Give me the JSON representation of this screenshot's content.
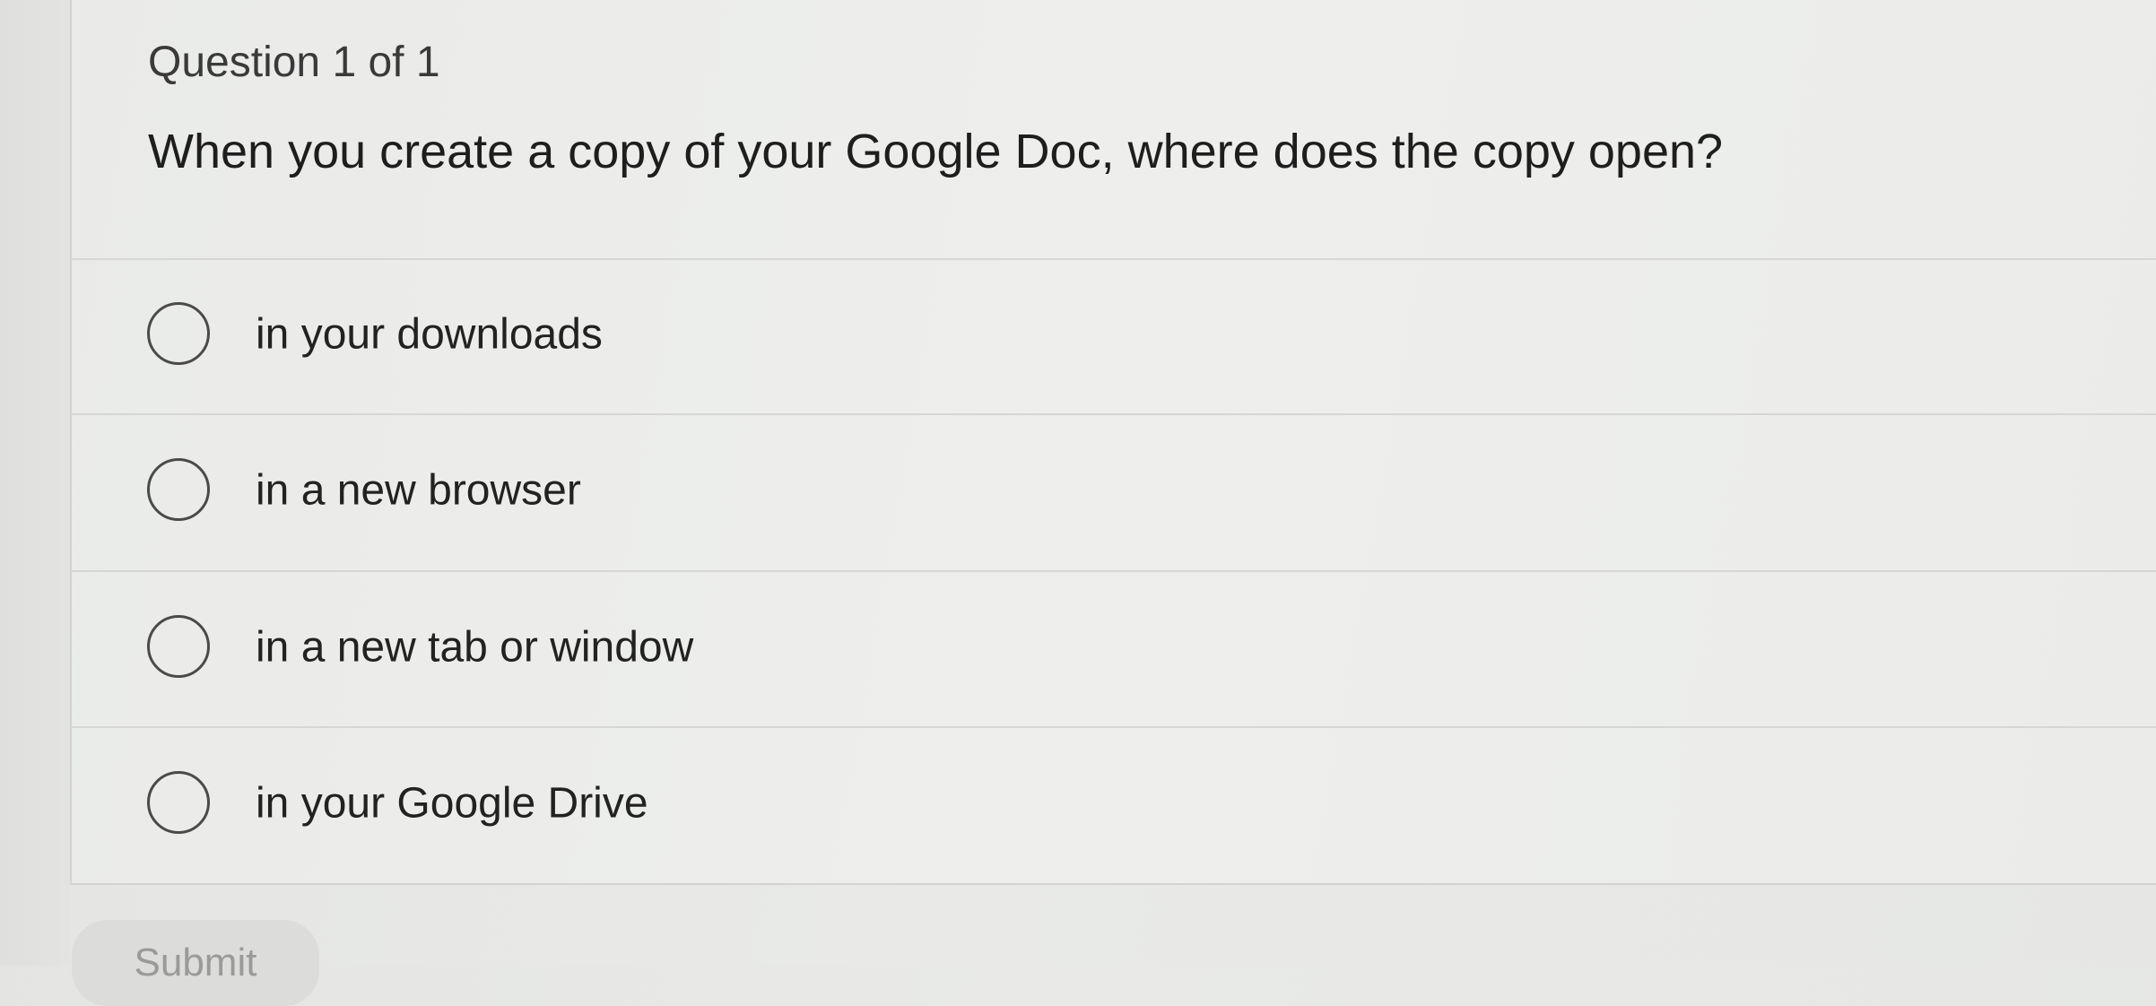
{
  "question": {
    "counter": "Question 1 of 1",
    "text": "When you create a copy of your Google Doc, where does the copy open?"
  },
  "options": [
    {
      "label": "in your downloads",
      "selected": false
    },
    {
      "label": "in a new browser",
      "selected": false
    },
    {
      "label": "in a new tab or window",
      "selected": false
    },
    {
      "label": "in your Google Drive",
      "selected": false
    }
  ],
  "submit": {
    "label": "Submit",
    "enabled": false
  }
}
